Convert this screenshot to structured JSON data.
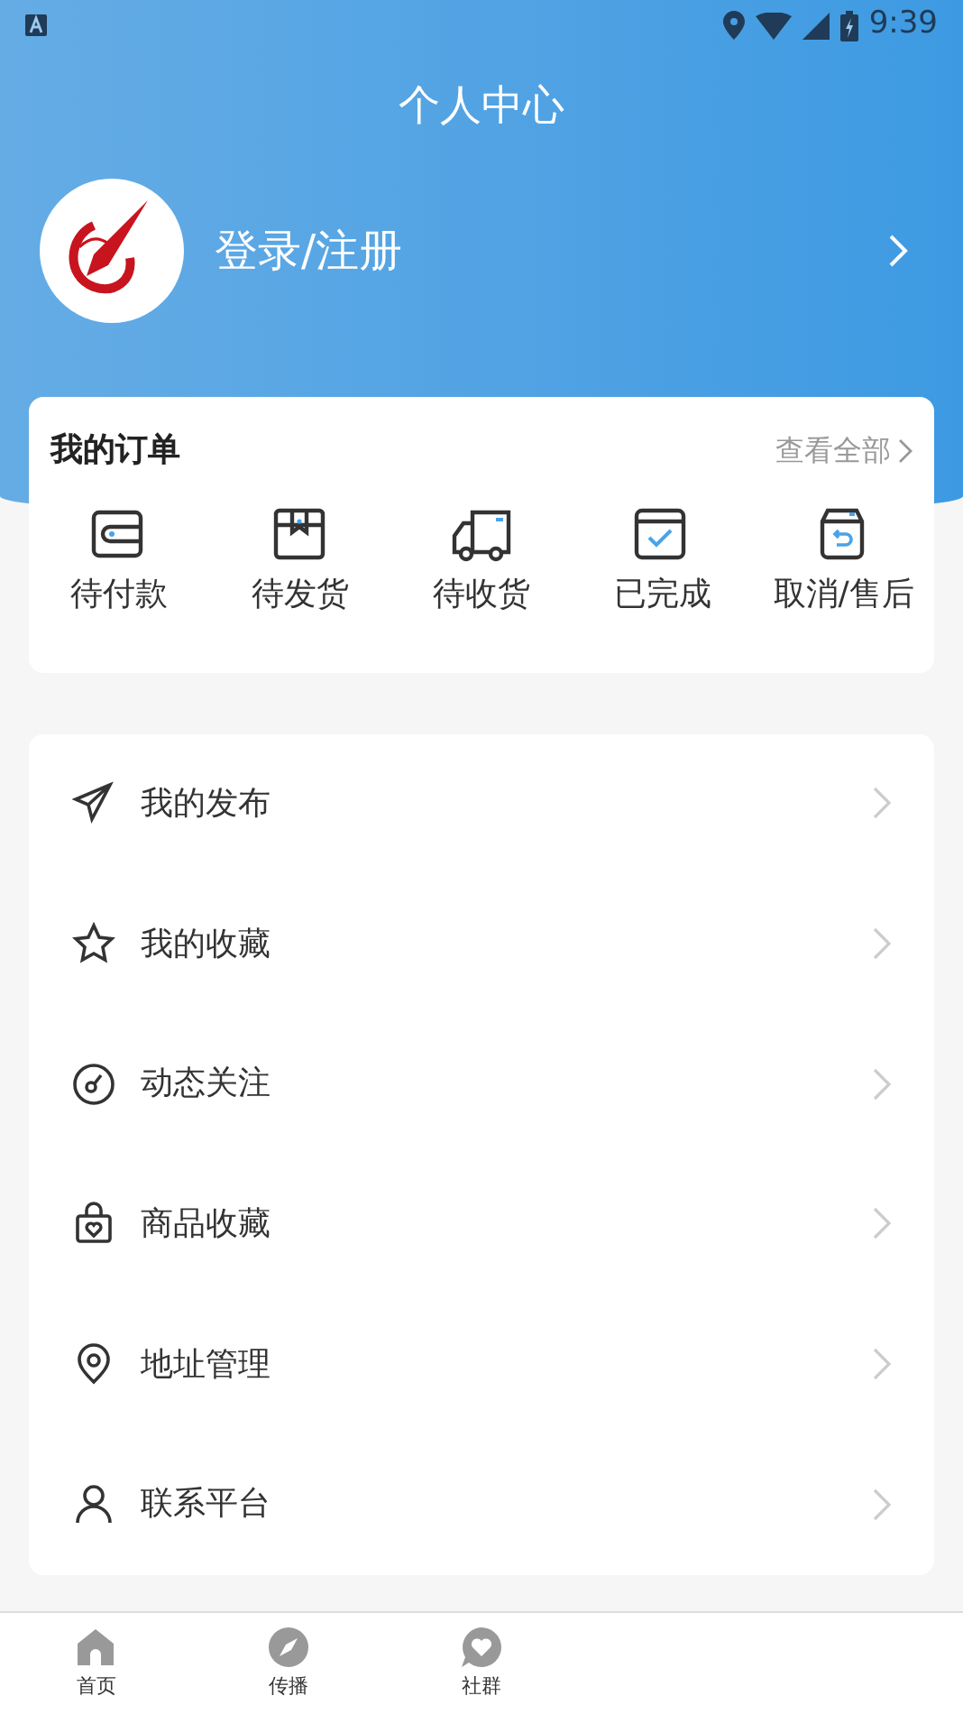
{
  "status_bar": {
    "time": "9:39"
  },
  "header": {
    "title": "个人中心"
  },
  "profile": {
    "label": "登录/注册"
  },
  "orders": {
    "title": "我的订单",
    "view_all": "查看全部",
    "items": [
      {
        "label": "待付款"
      },
      {
        "label": "待发货"
      },
      {
        "label": "待收货"
      },
      {
        "label": "已完成"
      },
      {
        "label": "取消/售后"
      }
    ]
  },
  "menu": {
    "items": [
      {
        "label": "我的发布"
      },
      {
        "label": "我的收藏"
      },
      {
        "label": "动态关注"
      },
      {
        "label": "商品收藏"
      },
      {
        "label": "地址管理"
      },
      {
        "label": "联系平台"
      }
    ]
  },
  "tab_bar": {
    "items": [
      {
        "label": "首页"
      },
      {
        "label": "传播"
      },
      {
        "label": "社群"
      }
    ]
  }
}
